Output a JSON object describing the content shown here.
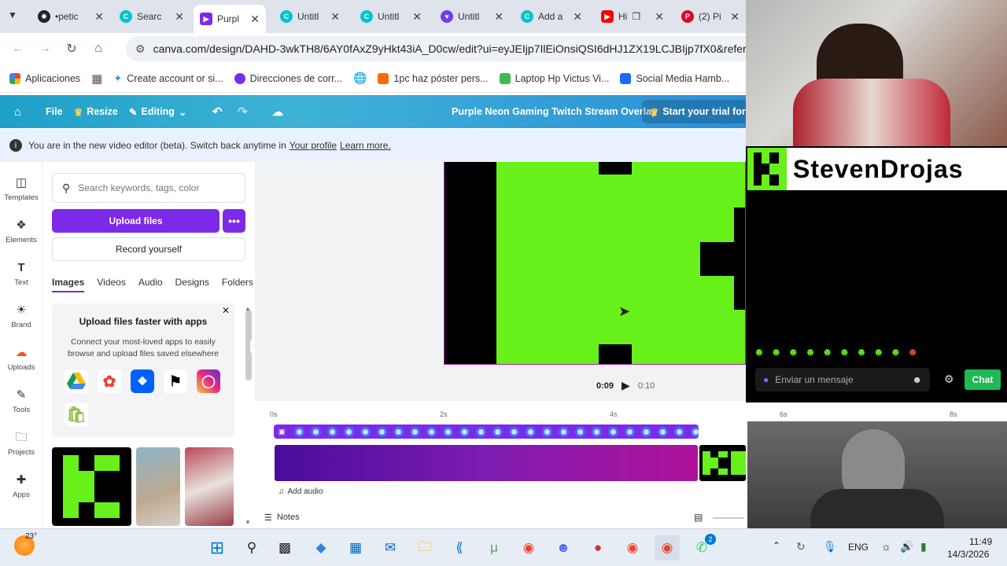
{
  "browser": {
    "tabs": [
      {
        "label": "•petic",
        "icon": "openai-icon",
        "color": "#222222"
      },
      {
        "label": "Searc",
        "icon": "canva-icon",
        "color": "#00c4cc"
      },
      {
        "label": "Purpl",
        "icon": "canva-video-icon",
        "color": "#7d2ae8"
      },
      {
        "label": "Untitl",
        "icon": "canva-icon",
        "color": "#00c4cc"
      },
      {
        "label": "Untitl",
        "icon": "canva-icon",
        "color": "#00c4cc"
      },
      {
        "label": "Untitl",
        "icon": "heart-icon",
        "color": "#6f3ef0"
      },
      {
        "label": "Add a",
        "icon": "canva-icon",
        "color": "#00c4cc"
      },
      {
        "label": "Hi",
        "icon": "youtube-icon",
        "color": "#ff0000"
      },
      {
        "label": "(2) Pi",
        "icon": "pinterest-icon",
        "color": "#e60023"
      }
    ],
    "url": "canva.com/design/DAHD-3wkTH8/6AY0fAxZ9yHkt43iA_D0cw/edit?ui=eyJEIjp7IlEiOnsiQSI6dHJ1ZX19LCJBIjp7fX0&referrer=",
    "bookmarks": [
      {
        "label": "Aplicaciones",
        "color": "#ea4335"
      },
      {
        "label": "",
        "color": "#555555"
      },
      {
        "label": "Create account or si...",
        "color": "#4285f4"
      },
      {
        "label": "Direcciones de corr...",
        "color": "#7d2ae8"
      },
      {
        "label": "",
        "color": "#666666"
      },
      {
        "label": "1pc haz póster pers...",
        "color": "#ff6a00"
      },
      {
        "label": "Laptop Hp Victus Vi...",
        "color": "#3fb950"
      },
      {
        "label": "Social Media Hamb...",
        "color": "#1769ff"
      }
    ]
  },
  "canva": {
    "file": "File",
    "resize": "Resize",
    "editing": "Editing",
    "title": "Purple Neon Gaming Twitch Stream Overlay",
    "trial": "Start your trial for RE",
    "info": "You are in the new video editor (beta). Switch back anytime in",
    "info_link1": "Your profile",
    "info_link2": "Learn more.",
    "rail": [
      "Templates",
      "Elements",
      "Text",
      "Brand",
      "Uploads",
      "Tools",
      "Projects",
      "Apps"
    ],
    "search_placeholder": "Search keywords, tags, color",
    "upload": "Upload files",
    "record": "Record yourself",
    "tabs": [
      "Images",
      "Videos",
      "Audio",
      "Designs",
      "Folders"
    ],
    "promo_title": "Upload files faster with apps",
    "promo_desc": "Connect your most-loved apps to easily browse and upload files saved elsewhere",
    "time_current": "0:09",
    "time_total": "0:10",
    "ruler": [
      "0s",
      "2s",
      "4s",
      "6s",
      "8s"
    ],
    "add_audio": "Add audio",
    "notes": "Notes"
  },
  "overlay": {
    "streamer": "StevenDrojas",
    "chat_placeholder": "Enviar un mensaje",
    "chat_button": "Chat"
  },
  "taskbar": {
    "weather": "23°",
    "lang": "ENG",
    "time": "11:49",
    "date": "14/3/2026",
    "whatsapp_badge": "2"
  }
}
